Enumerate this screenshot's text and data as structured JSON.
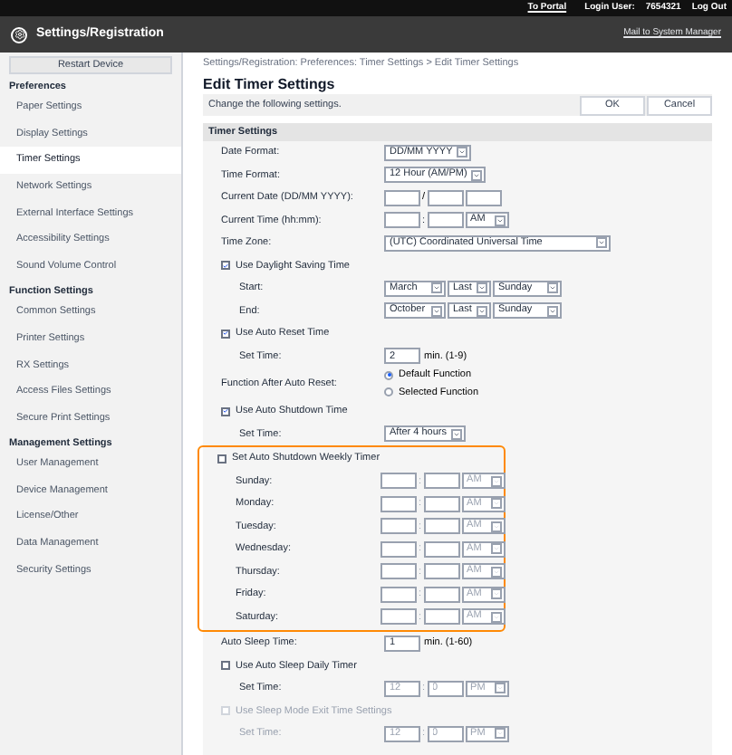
{
  "top_bar": {
    "portal_link": "To Portal",
    "login_label": "Login User:",
    "login_user": "7654321",
    "logout_link": "Log Out"
  },
  "header": {
    "title": "Settings/Registration",
    "mail_link": "Mail to System Manager"
  },
  "sidebar": {
    "restart_button": "Restart Device",
    "sections": [
      {
        "title": "Preferences",
        "items": [
          {
            "label": "Paper Settings",
            "selected": false
          },
          {
            "label": "Display Settings",
            "selected": false
          },
          {
            "label": "Timer Settings",
            "selected": true
          },
          {
            "label": "Network Settings",
            "selected": false
          },
          {
            "label": "External Interface Settings",
            "selected": false
          },
          {
            "label": "Accessibility Settings",
            "selected": false
          },
          {
            "label": "Sound Volume Control",
            "selected": false
          }
        ]
      },
      {
        "title": "Function Settings",
        "items": [
          {
            "label": "Common Settings",
            "selected": false
          },
          {
            "label": "Printer Settings",
            "selected": false
          },
          {
            "label": "RX Settings",
            "selected": false
          },
          {
            "label": "Access Files Settings",
            "selected": false
          },
          {
            "label": "Secure Print Settings",
            "selected": false
          }
        ]
      },
      {
        "title": "Management Settings",
        "items": [
          {
            "label": "User Management",
            "selected": false
          },
          {
            "label": "Device Management",
            "selected": false
          },
          {
            "label": "License/Other",
            "selected": false
          },
          {
            "label": "Data Management",
            "selected": false
          },
          {
            "label": "Security Settings",
            "selected": false
          }
        ]
      }
    ]
  },
  "main": {
    "breadcrumb": "Settings/Registration: Preferences: Timer Settings > Edit Timer Settings",
    "title": "Edit Timer Settings",
    "instruction": "Change the following settings.",
    "buttons": [
      "OK",
      "Cancel"
    ],
    "section_title": "Timer Settings",
    "rows": [
      {
        "kind": "select",
        "label": "Date Format:",
        "values": [
          "DD/MM YYYY"
        ]
      },
      {
        "kind": "select",
        "label": "Time Format:",
        "values": [
          "12 Hour (AM/PM)"
        ]
      },
      {
        "kind": "date",
        "label": "Current Date (DD/MM YYYY):",
        "separator": "/"
      },
      {
        "kind": "time",
        "label": "Current Time (hh:mm):",
        "separator": ":",
        "ampm": "AM",
        "disabled": false
      },
      {
        "kind": "select",
        "label": "Time Zone:",
        "values": [
          "(UTC) Coordinated Universal Time"
        ],
        "wide": true
      },
      {
        "kind": "checkbox",
        "label": "Use Daylight Saving Time",
        "checked": true,
        "disabled": false,
        "highlighted": false,
        "children": [
          {
            "kind": "select",
            "label": "Start:",
            "values": [
              "March",
              "Last",
              "Sunday"
            ]
          },
          {
            "kind": "select",
            "label": "End:",
            "values": [
              "October",
              "Last",
              "Sunday"
            ]
          }
        ]
      },
      {
        "kind": "checkbox",
        "label": "Use Auto Reset Time",
        "checked": true,
        "disabled": false,
        "highlighted": false,
        "children": [
          {
            "kind": "number",
            "label": "Set Time:",
            "value": "2",
            "unit": "min. (1-9)"
          }
        ]
      },
      {
        "kind": "radio",
        "label": "Function After Auto Reset:",
        "options": [
          {
            "label": "Default Function",
            "selected": true
          },
          {
            "label": "Selected Function",
            "selected": false
          }
        ]
      },
      {
        "kind": "checkbox",
        "label": "Use Auto Shutdown Time",
        "checked": true,
        "disabled": false,
        "highlighted": false,
        "children": [
          {
            "kind": "select",
            "label": "Set Time:",
            "values": [
              "After 4 hours"
            ]
          }
        ]
      },
      {
        "kind": "checkbox",
        "label": "Set Auto Shutdown Weekly Timer",
        "checked": false,
        "disabled": false,
        "highlighted": true,
        "children": [
          {
            "kind": "time",
            "label": "Sunday:",
            "separator": ":",
            "ampm": "AM",
            "disabled": true
          },
          {
            "kind": "time",
            "label": "Monday:",
            "separator": ":",
            "ampm": "AM",
            "disabled": true
          },
          {
            "kind": "time",
            "label": "Tuesday:",
            "separator": ":",
            "ampm": "AM",
            "disabled": true
          },
          {
            "kind": "time",
            "label": "Wednesday:",
            "separator": ":",
            "ampm": "AM",
            "disabled": true
          },
          {
            "kind": "time",
            "label": "Thursday:",
            "separator": ":",
            "ampm": "AM",
            "disabled": true
          },
          {
            "kind": "time",
            "label": "Friday:",
            "separator": ":",
            "ampm": "AM",
            "disabled": true
          },
          {
            "kind": "time",
            "label": "Saturday:",
            "separator": ":",
            "ampm": "AM",
            "disabled": true
          }
        ]
      },
      {
        "kind": "number",
        "label": "Auto Sleep Time:",
        "value": "1",
        "unit": "min. (1-60)"
      },
      {
        "kind": "checkbox",
        "label": "Use Auto Sleep Daily Timer",
        "checked": false,
        "disabled": false,
        "highlighted": false,
        "children": [
          {
            "kind": "time",
            "label": "Set Time:",
            "separator": ":",
            "hour": "12",
            "minute": "0",
            "ampm": "PM",
            "disabled": true
          }
        ]
      },
      {
        "kind": "checkbox",
        "label": "Use Sleep Mode Exit Time Settings",
        "checked": false,
        "disabled": true,
        "highlighted": false,
        "children": [
          {
            "kind": "time",
            "label": "Set Time:",
            "separator": ":",
            "hour": "12",
            "minute": "0",
            "ampm": "PM",
            "disabled": true
          }
        ]
      }
    ]
  }
}
